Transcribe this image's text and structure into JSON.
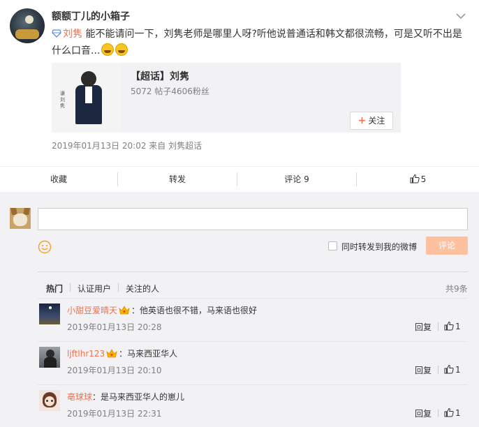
{
  "post": {
    "username": "额额丁儿的小箱子",
    "topic_link": "刘隽",
    "text": " 能不能请问一下，刘隽老师是哪里人呀?听他说普通话和韩文都很流畅，可是又听不出是什么口音...",
    "card": {
      "title": "【超话】刘隽",
      "stats": "5072 帖子4606粉丝",
      "image_vertical_text": "谦 刘 隽",
      "follow_label": "关注"
    },
    "meta": "2019年01月13日 20:02  来自 刘隽超话"
  },
  "actions": {
    "favorite": "收藏",
    "repost": "转发",
    "comment": "评论 9",
    "like_count": "5"
  },
  "composer": {
    "placeholder": "",
    "repost_label": "同时转发到我的微博",
    "submit_label": "评论"
  },
  "filters": {
    "hot": "热门",
    "verified": "认证用户",
    "following": "关注的人",
    "total": "共9条"
  },
  "comments": [
    {
      "user": "小甜豆爱晴天",
      "crown": true,
      "text": "：他英语也很不错，马来语也很好",
      "time": "2019年01月13日 20:28",
      "reply": "回复",
      "likes": "1"
    },
    {
      "user": "ljftlhr123",
      "crown": true,
      "text": "：马来西亚华人",
      "time": "2019年01月13日 20:10",
      "reply": "回复",
      "likes": "1"
    },
    {
      "user": "亳球球",
      "crown": false,
      "text": "：是马来西亚华人的崽儿",
      "time": "2019年01月13日 22:31",
      "reply": "回复",
      "likes": "1"
    }
  ],
  "colors": {
    "accent": "#eb7350",
    "submit_disabled": "#ffc09f",
    "panel_bg": "#f2f2f5"
  }
}
